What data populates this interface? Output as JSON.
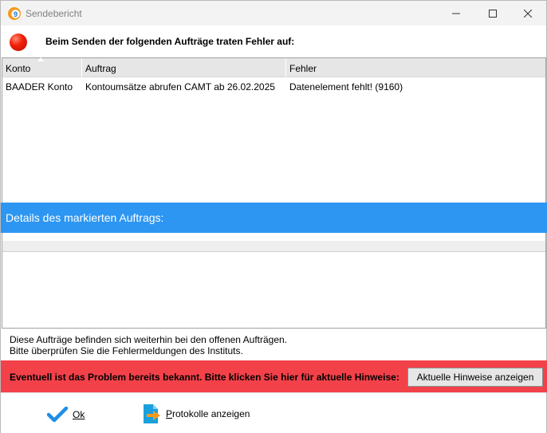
{
  "window": {
    "title": "Sendebericht"
  },
  "header": {
    "message": "Beim Senden der folgenden Aufträge traten Fehler auf:"
  },
  "table": {
    "columns": [
      "Konto",
      "Auftrag",
      "Fehler"
    ],
    "rows": [
      [
        "BAADER Konto",
        "Kontoumsätze abrufen CAMT ab 26.02.2025",
        "Datenelement fehlt! (9160)"
      ]
    ]
  },
  "details": {
    "title": "Details des markierten Auftrags:"
  },
  "info": {
    "line1": "Diese Aufträge befinden sich weiterhin bei den offenen Aufträgen.",
    "line2": "Bitte überprüfen Sie die Fehlermeldungen des Instituts."
  },
  "banner": {
    "text": "Eventuell ist das Problem bereits bekannt. Bitte klicken Sie hier für aktuelle Hinweise:",
    "button_label": "Aktuelle Hinweise anzeigen",
    "color": "#f3414a"
  },
  "footer": {
    "ok_label": "Ok",
    "protocol_label_first": "P",
    "protocol_label_rest": "rotokolle anzeigen"
  },
  "colors": {
    "accent": "#2d96f2",
    "error": "#f2210a",
    "ok_check": "#1f8ee6"
  },
  "icons": {
    "app": "app-logo-icon",
    "status": "error-dot-icon",
    "ok": "checkmark-icon",
    "protocol": "document-arrow-icon"
  }
}
